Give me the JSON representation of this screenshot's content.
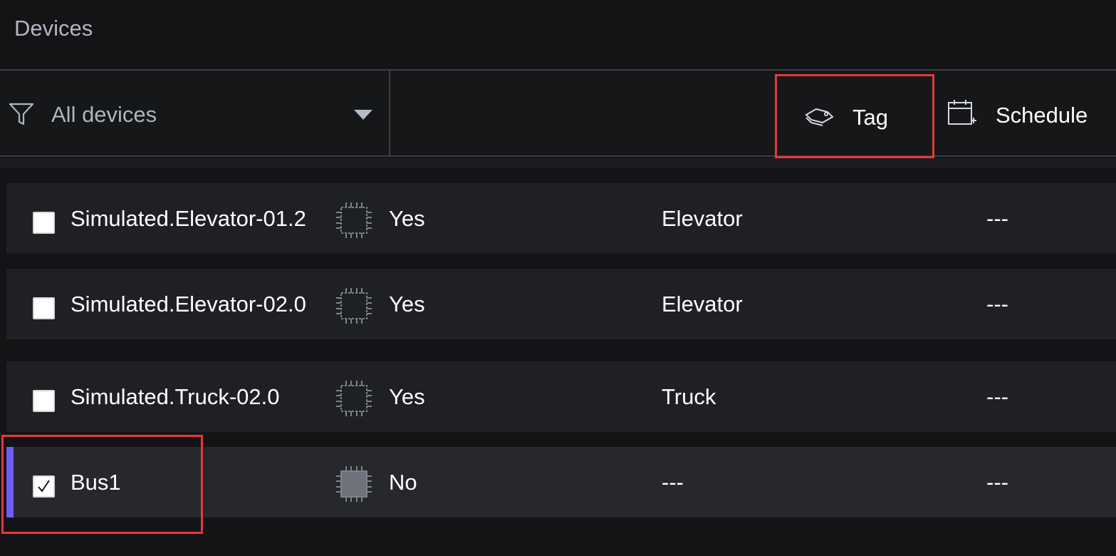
{
  "header": {
    "title": "Devices"
  },
  "toolbar": {
    "filter": {
      "label": "All devices",
      "icon": "funnel-icon",
      "caret": "chevron-down-icon"
    },
    "tag": {
      "label": "Tag",
      "icon": "tags-icon"
    },
    "schedule": {
      "label": "Schedule",
      "icon": "calendar-add-icon"
    }
  },
  "rows": [
    {
      "name": "Simulated.Elevator-01.2",
      "edge": "Yes",
      "type": "Elevator",
      "last": "---",
      "checked": false
    },
    {
      "name": "Simulated.Elevator-02.0",
      "edge": "Yes",
      "type": "Elevator",
      "last": "---",
      "checked": false
    },
    {
      "name": "Simulated.Truck-02.0",
      "edge": "Yes",
      "type": "Truck",
      "last": "---",
      "checked": false
    },
    {
      "name": "Bus1",
      "edge": "No",
      "type": "---",
      "last": "---",
      "checked": true
    }
  ],
  "colors": {
    "background": "#141416",
    "row": "#1f2023",
    "highlight_frame": "#e5383b",
    "selection_accent": "#6b5cf6"
  }
}
